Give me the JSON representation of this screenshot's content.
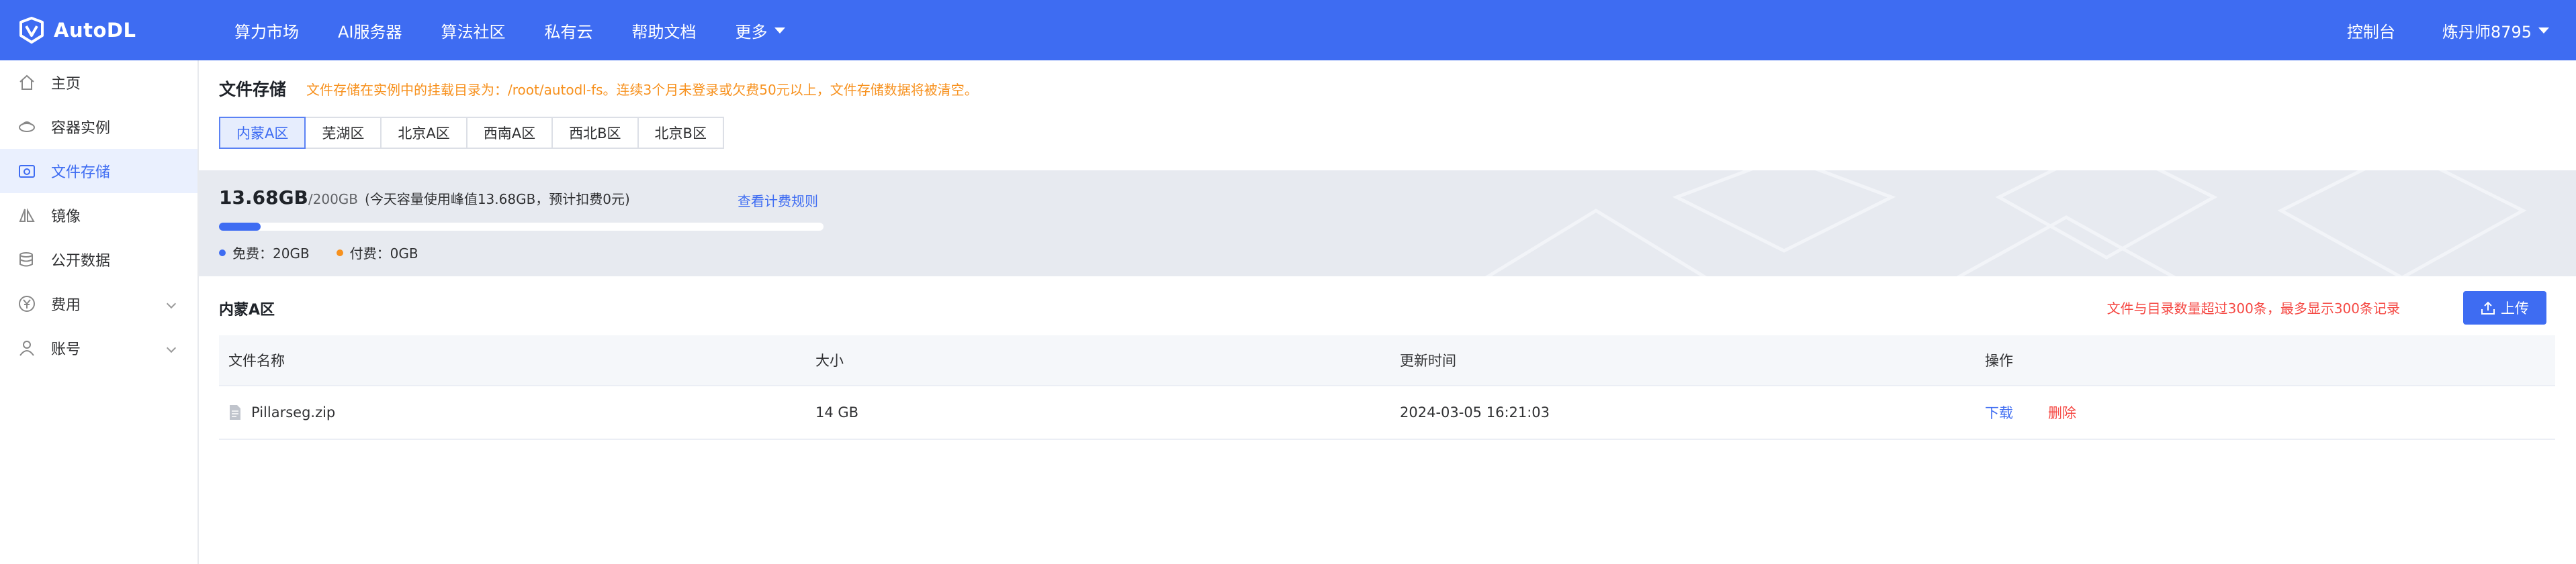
{
  "header": {
    "logo_text": "AutoDL",
    "nav": [
      {
        "label": "算力市场"
      },
      {
        "label": "AI服务器"
      },
      {
        "label": "算法社区"
      },
      {
        "label": "私有云"
      },
      {
        "label": "帮助文档"
      },
      {
        "label": "更多"
      }
    ],
    "console_label": "控制台",
    "user_label": "炼丹师8795"
  },
  "sidebar": {
    "items": [
      {
        "label": "主页",
        "icon": "home-icon"
      },
      {
        "label": "容器实例",
        "icon": "container-icon"
      },
      {
        "label": "文件存储",
        "icon": "storage-icon",
        "active": true
      },
      {
        "label": "镜像",
        "icon": "image-icon"
      },
      {
        "label": "公开数据",
        "icon": "database-icon"
      },
      {
        "label": "费用",
        "icon": "yen-icon",
        "expandable": true
      },
      {
        "label": "账号",
        "icon": "user-icon",
        "expandable": true
      }
    ]
  },
  "main": {
    "title": "文件存储",
    "notice": "文件存储在实例中的挂载目录为：/root/autodl-fs。连续3个月未登录或欠费50元以上，文件存储数据将被清空。",
    "regions": [
      "内蒙A区",
      "芜湖区",
      "北京A区",
      "西南A区",
      "西北B区",
      "北京B区"
    ],
    "active_region": "内蒙A区",
    "usage": {
      "used": "13.68GB",
      "total": "/200GB",
      "note": "(今天容量使用峰值13.68GB，预计扣费0元)",
      "billing_link": "查看计费规则",
      "fraction": 0.0684,
      "free_label": "免费：20GB",
      "paid_label": "付费：0GB",
      "free_color": "#3e6cf2",
      "paid_color": "#f7911e"
    },
    "section_title": "内蒙A区",
    "warning": "文件与目录数量超过300条，最多显示300条记录",
    "upload_label": "上传",
    "table": {
      "headers": [
        "文件名称",
        "大小",
        "更新时间",
        "操作"
      ],
      "rows": [
        {
          "name": "Pillarseg.zip",
          "size": "14 GB",
          "updated": "2024-03-05 16:21:03",
          "download": "下载",
          "delete": "删除"
        }
      ]
    }
  }
}
